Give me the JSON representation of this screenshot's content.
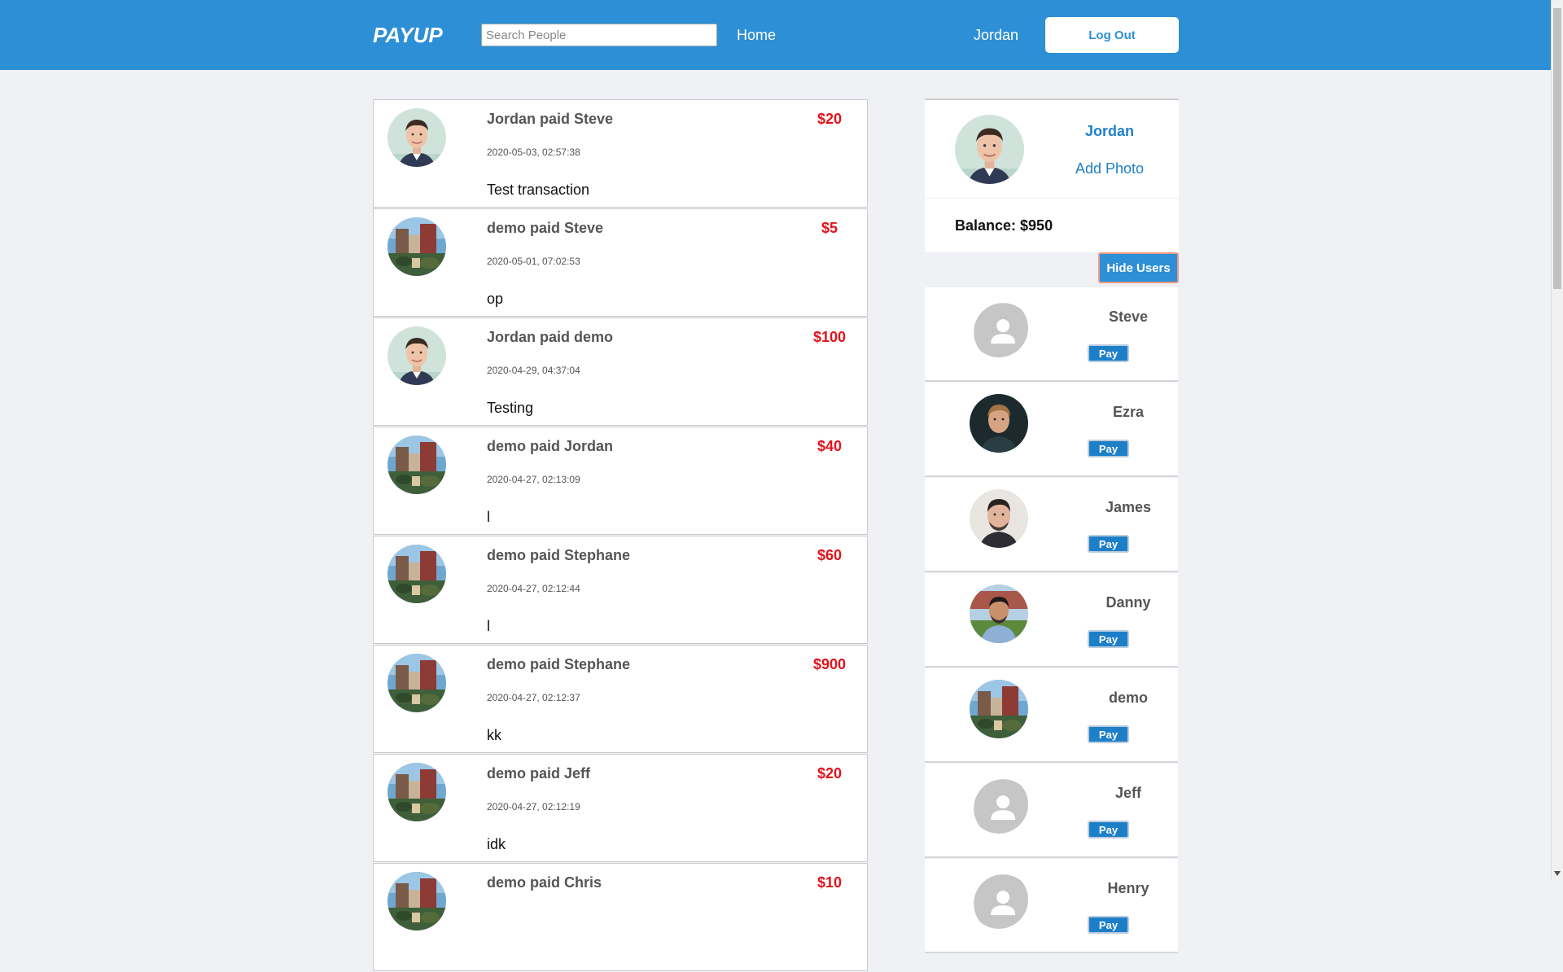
{
  "header": {
    "logo": "PAYUP",
    "search_placeholder": "Search People",
    "nav_home": "Home",
    "nav_user": "Jordan",
    "logout_label": "Log Out"
  },
  "transactions": [
    {
      "title": "Jordan paid Steve",
      "amount": "$20",
      "date": "2020-05-03, 02:57:38",
      "memo": "Test transaction",
      "avatar": "jordan-avatar"
    },
    {
      "title": "demo paid Steve",
      "amount": "$5",
      "date": "2020-05-01, 07:02:53",
      "memo": "op",
      "avatar": "demo-avatar"
    },
    {
      "title": "Jordan paid demo",
      "amount": "$100",
      "date": "2020-04-29, 04:37:04",
      "memo": "Testing",
      "avatar": "jordan-avatar"
    },
    {
      "title": "demo paid Jordan",
      "amount": "$40",
      "date": "2020-04-27, 02:13:09",
      "memo": "l",
      "avatar": "demo-avatar"
    },
    {
      "title": "demo paid Stephane",
      "amount": "$60",
      "date": "2020-04-27, 02:12:44",
      "memo": "l",
      "avatar": "demo-avatar"
    },
    {
      "title": "demo paid Stephane",
      "amount": "$900",
      "date": "2020-04-27, 02:12:37",
      "memo": "kk",
      "avatar": "demo-avatar"
    },
    {
      "title": "demo paid Jeff",
      "amount": "$20",
      "date": "2020-04-27, 02:12:19",
      "memo": "idk",
      "avatar": "demo-avatar"
    },
    {
      "title": "demo paid Chris",
      "amount": "$10",
      "date": "",
      "memo": "",
      "avatar": "demo-avatar"
    }
  ],
  "profile": {
    "name": "Jordan",
    "add_photo": "Add Photo",
    "balance": "Balance: $950",
    "hide_users_label": "Hide Users"
  },
  "users": [
    {
      "name": "Steve",
      "pay_label": "Pay",
      "avatar": "placeholder"
    },
    {
      "name": "Ezra",
      "pay_label": "Pay",
      "avatar": "photo-dark"
    },
    {
      "name": "James",
      "pay_label": "Pay",
      "avatar": "photo-light"
    },
    {
      "name": "Danny",
      "pay_label": "Pay",
      "avatar": "photo-outdoor"
    },
    {
      "name": "demo",
      "pay_label": "Pay",
      "avatar": "demo-avatar"
    },
    {
      "name": "Jeff",
      "pay_label": "Pay",
      "avatar": "placeholder"
    },
    {
      "name": "Henry",
      "pay_label": "Pay",
      "avatar": "placeholder"
    }
  ],
  "colors": {
    "brand_blue": "#2d8fd5",
    "amount_red": "#e3131c",
    "link_blue": "#1e7fc9",
    "page_bg": "#eff1f5"
  }
}
